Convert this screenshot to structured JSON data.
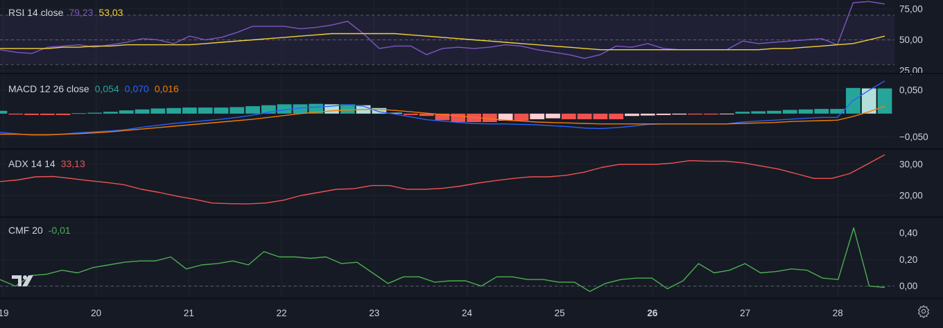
{
  "chart_data": [
    {
      "type": "line",
      "name": "RSI 14 close",
      "legend_values": [
        "79,23",
        "53,03"
      ],
      "legend_colors": [
        "#7e57c2",
        "#f5d33c"
      ],
      "yaxis_ticks": [
        "75,00",
        "50,00",
        "25,00"
      ],
      "ylim": [
        25,
        80
      ],
      "bands": [
        30,
        70
      ],
      "middle_line": 50,
      "series": [
        {
          "color": "#7e57c2",
          "values": [
            42,
            40,
            39,
            44,
            45,
            46,
            44,
            46,
            48,
            51,
            50,
            47,
            53,
            50,
            52,
            56,
            61,
            61,
            61,
            59,
            60,
            62,
            65,
            55,
            43,
            45,
            45,
            38,
            43,
            44,
            43,
            44,
            46,
            45,
            42,
            40,
            38,
            35,
            38,
            45,
            44,
            47,
            43,
            42,
            42,
            42,
            42,
            49,
            47,
            48,
            49,
            50,
            51,
            46,
            80,
            81,
            79
          ]
        },
        {
          "color": "#f5d33c",
          "values": [
            43,
            43,
            43,
            43,
            44,
            44,
            45,
            45,
            46,
            46,
            46,
            46,
            46,
            47,
            48,
            49,
            50,
            51,
            52,
            53,
            54,
            55,
            55,
            55,
            55,
            55,
            54,
            53,
            52,
            51,
            50,
            49,
            48,
            47,
            46,
            45,
            44,
            43,
            42,
            42,
            42,
            42,
            42,
            42,
            42,
            42,
            42,
            42,
            42,
            43,
            43,
            44,
            45,
            46,
            47,
            50,
            53
          ]
        }
      ]
    },
    {
      "type": "bar",
      "name": "MACD 12 26 close",
      "legend_values": [
        "0,054",
        "0,070",
        "0,016"
      ],
      "legend_colors": [
        "#26a69a",
        "#2962ff",
        "#f57c00"
      ],
      "yaxis_ticks": [
        "0,050",
        "-0,050"
      ],
      "ylim": [
        -0.07,
        0.08
      ],
      "histogram": [
        0.006,
        -0.002,
        -0.003,
        -0.003,
        -0.003,
        0.001,
        0.002,
        0.004,
        0.007,
        0.009,
        0.011,
        0.012,
        0.013,
        0.013,
        0.013,
        0.014,
        0.016,
        0.018,
        0.02,
        0.02,
        0.021,
        0.02,
        0.02,
        0.018,
        0.012,
        0.002,
        -0.003,
        -0.005,
        -0.014,
        -0.018,
        -0.018,
        -0.018,
        -0.015,
        -0.015,
        -0.012,
        -0.01,
        -0.012,
        -0.012,
        -0.012,
        -0.012,
        -0.005,
        -0.004,
        -0.003,
        -0.002,
        -0.002,
        -0.002,
        -0.001,
        0.004,
        0.005,
        0.006,
        0.008,
        0.009,
        0.01,
        0.01,
        0.055,
        0.054,
        0.054
      ],
      "series": [
        {
          "color": "#2962ff",
          "values": [
            -0.04,
            -0.043,
            -0.046,
            -0.046,
            -0.044,
            -0.041,
            -0.039,
            -0.037,
            -0.034,
            -0.029,
            -0.025,
            -0.021,
            -0.018,
            -0.015,
            -0.012,
            -0.008,
            -0.003,
            0.003,
            0.008,
            0.012,
            0.014,
            0.016,
            0.019,
            0.016,
            0.004,
            -0.001,
            -0.007,
            -0.013,
            -0.016,
            -0.019,
            -0.021,
            -0.022,
            -0.022,
            -0.023,
            -0.024,
            -0.026,
            -0.028,
            -0.031,
            -0.032,
            -0.03,
            -0.027,
            -0.023,
            -0.022,
            -0.022,
            -0.022,
            -0.022,
            -0.022,
            -0.018,
            -0.016,
            -0.014,
            -0.012,
            -0.01,
            -0.008,
            -0.008,
            0.028,
            0.05,
            0.07
          ]
        },
        {
          "color": "#f57c00",
          "values": [
            -0.044,
            -0.044,
            -0.045,
            -0.045,
            -0.044,
            -0.043,
            -0.041,
            -0.039,
            -0.036,
            -0.033,
            -0.03,
            -0.027,
            -0.024,
            -0.021,
            -0.018,
            -0.015,
            -0.012,
            -0.008,
            -0.004,
            0.0,
            0.003,
            0.006,
            0.008,
            0.009,
            0.009,
            0.007,
            0.004,
            0.001,
            -0.002,
            -0.005,
            -0.008,
            -0.011,
            -0.014,
            -0.016,
            -0.018,
            -0.019,
            -0.02,
            -0.021,
            -0.022,
            -0.022,
            -0.022,
            -0.022,
            -0.022,
            -0.022,
            -0.022,
            -0.022,
            -0.022,
            -0.021,
            -0.02,
            -0.019,
            -0.017,
            -0.016,
            -0.015,
            -0.014,
            -0.006,
            0.004,
            0.016
          ]
        }
      ]
    },
    {
      "type": "line",
      "name": "ADX 14 14",
      "legend_values": [
        "33,13"
      ],
      "legend_colors": [
        "#ef5350"
      ],
      "yaxis_ticks": [
        "30,00",
        "20,00"
      ],
      "ylim": [
        14,
        34
      ],
      "series": [
        {
          "color": "#ef5350",
          "values": [
            24.5,
            25,
            26,
            26.1,
            25.5,
            24.8,
            24.2,
            23.5,
            22,
            21,
            19.8,
            18.8,
            17.6,
            17.4,
            17.3,
            17.6,
            18.5,
            20,
            21,
            22,
            22.2,
            23.2,
            23.2,
            22,
            22,
            22.3,
            23,
            24,
            24.8,
            25.5,
            26,
            26,
            26.5,
            27.5,
            29,
            30,
            30,
            30,
            30.4,
            31.2,
            31,
            31,
            30.5,
            29.5,
            28.5,
            27,
            25.5,
            25.5,
            27,
            30,
            33.1
          ]
        }
      ]
    },
    {
      "type": "line",
      "name": "CMF 20",
      "legend_values": [
        "-0,01"
      ],
      "legend_colors": [
        "#4caf50"
      ],
      "yaxis_ticks": [
        "0,40",
        "0,20",
        "0,00"
      ],
      "ylim": [
        -0.07,
        0.5
      ],
      "series": [
        {
          "color": "#4caf50",
          "values": [
            0.05,
            0.0,
            0.08,
            0.09,
            0.12,
            0.1,
            0.14,
            0.16,
            0.18,
            0.19,
            0.19,
            0.22,
            0.13,
            0.16,
            0.17,
            0.19,
            0.16,
            0.26,
            0.22,
            0.22,
            0.21,
            0.22,
            0.17,
            0.18,
            0.1,
            0.02,
            0.07,
            0.07,
            0.03,
            0.04,
            0.04,
            0.0,
            0.07,
            0.07,
            0.05,
            0.05,
            0.03,
            0.03,
            -0.04,
            0.02,
            0.05,
            0.06,
            0.06,
            -0.02,
            0.04,
            0.17,
            0.1,
            0.12,
            0.17,
            0.1,
            0.11,
            0.13,
            0.12,
            0.06,
            0.05,
            0.44,
            0.0,
            -0.01
          ]
        }
      ]
    }
  ],
  "time_axis": [
    "19",
    "20",
    "21",
    "22",
    "23",
    "24",
    "25",
    "26",
    "27",
    "28"
  ],
  "bold_ticks": [
    "26"
  ],
  "logo_text": "17",
  "colors": {
    "background": "#161a25",
    "grid": "#1f2430",
    "separator": "#0d0f15",
    "axis_text": "#d1d4dc",
    "rsi_band": "#7e57c2",
    "hist_up": "#26a69a",
    "hist_up_weak": "#b2dfdb",
    "hist_down": "#ef5350",
    "hist_down_weak": "#ffcdd2"
  },
  "icons": {
    "settings": "gear-icon",
    "logo": "tradingview-logo"
  }
}
